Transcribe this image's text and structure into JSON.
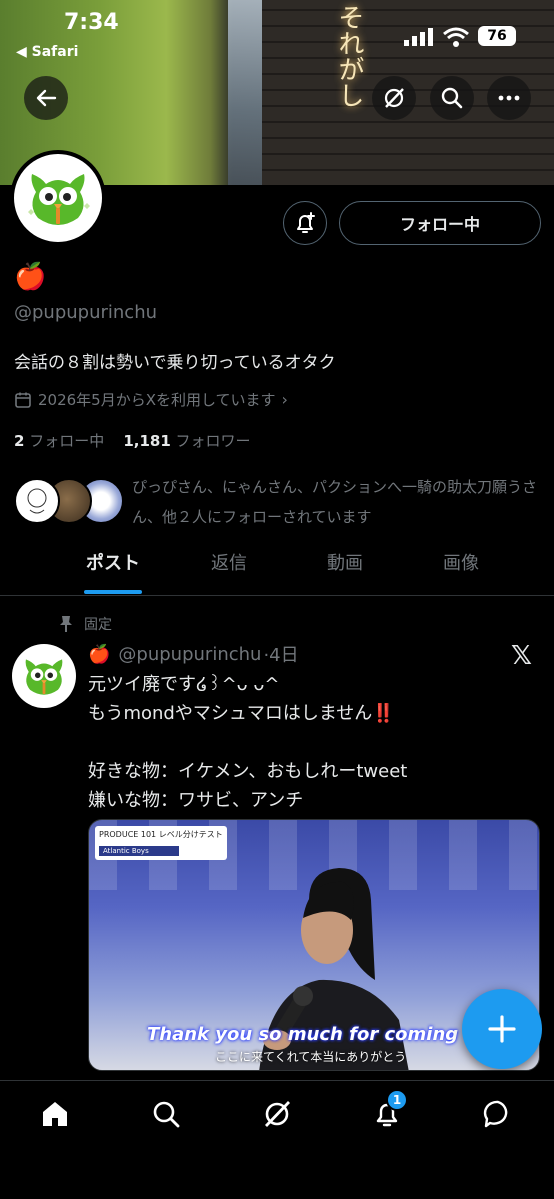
{
  "status_bar": {
    "time": "7:34",
    "back_app": "◀ Safari",
    "battery": "76"
  },
  "profile": {
    "name_emoji": "🍎",
    "handle": "@pupupurinchu",
    "bio": "会話の８割は勢いで乗り切っているオタク",
    "joined": "2026年5月からXを利用しています",
    "following_count": "2",
    "following_label": "フォロー中",
    "followers_count": "1,181",
    "followers_label": "フォロワー",
    "mutuals_text": "ぴっぴさん、にゃんさん、パクションへ一騎の助太刀願うさん、他２人にフォローされています",
    "follow_button": "フォロー中"
  },
  "tabs": [
    {
      "label": "ポスト",
      "active": true
    },
    {
      "label": "返信",
      "active": false
    },
    {
      "label": "動画",
      "active": false
    },
    {
      "label": "画像",
      "active": false
    }
  ],
  "post": {
    "pinned_label": "固定",
    "author_emoji": "🍎",
    "handle": "@pupupurinchu",
    "time": "·4日",
    "body": "元ツイ廃です໒꒱^ᴗ ᴗ^\nもうmondやマシュマロはしません‼️\n\n好きな物：イケメン、おもしれーtweet\n嫌いな物：ワサビ、アンチ",
    "media": {
      "badge_top": "PRODUCE 101 レベル分けテスト",
      "badge_sub": "Atlantic Boys",
      "caption_en": "Thank you so much for coming",
      "caption_jp": "ここに来てくれて本当にありがとう"
    }
  },
  "nav": {
    "notifications_badge": "1"
  },
  "colors": {
    "accent": "#1d9bf0",
    "muted": "#71767b",
    "text": "#e7e9ea",
    "border": "#2f3336"
  }
}
